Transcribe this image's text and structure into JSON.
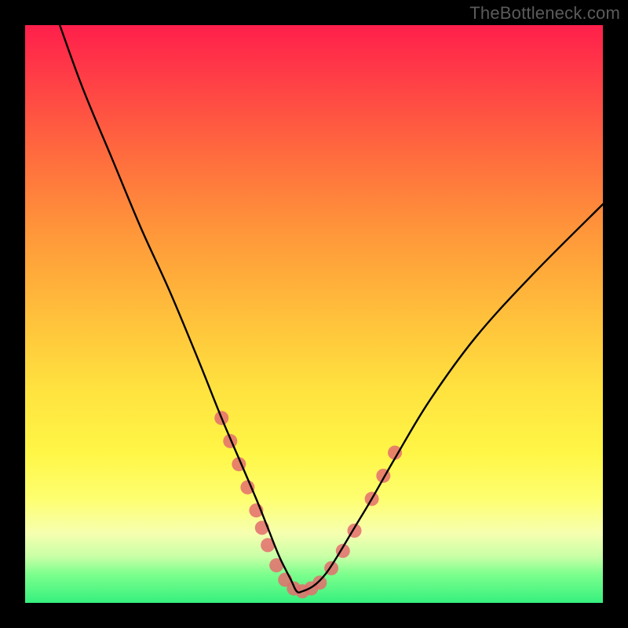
{
  "watermark": "TheBottleneck.com",
  "gradient_stops": [
    {
      "pct": 0,
      "color": "#ff1f4b"
    },
    {
      "pct": 8,
      "color": "#ff3a47"
    },
    {
      "pct": 22,
      "color": "#ff6a3e"
    },
    {
      "pct": 36,
      "color": "#ff973a"
    },
    {
      "pct": 50,
      "color": "#ffbf3b"
    },
    {
      "pct": 63,
      "color": "#ffe23f"
    },
    {
      "pct": 74,
      "color": "#fff646"
    },
    {
      "pct": 82,
      "color": "#feff70"
    },
    {
      "pct": 88,
      "color": "#f6ffb0"
    },
    {
      "pct": 92,
      "color": "#c8ffa6"
    },
    {
      "pct": 95,
      "color": "#7dff8d"
    },
    {
      "pct": 100,
      "color": "#36f07e"
    }
  ],
  "chart_data": {
    "type": "line",
    "title": "",
    "xlabel": "",
    "ylabel": "",
    "xlim": [
      0,
      100
    ],
    "ylim": [
      0,
      100
    ],
    "note": "Axes are unlabeled percent scales inferred from plot extents; y=100 at top, y=0 at bottom. Curve is a bottleneck V-shape with minimum near x≈47.",
    "series": [
      {
        "name": "bottleneck-curve",
        "color": "#000000",
        "x": [
          6,
          10,
          15,
          20,
          25,
          30,
          34,
          37,
          40,
          42,
          44,
          46,
          47,
          48,
          50,
          52,
          54,
          57,
          60,
          64,
          70,
          78,
          88,
          100
        ],
        "y": [
          100,
          89,
          77,
          65,
          54,
          42,
          32,
          25,
          18,
          13,
          8,
          4,
          2,
          2,
          3,
          5,
          8,
          13,
          18,
          25,
          35,
          46,
          57,
          69
        ]
      }
    ],
    "markers": {
      "name": "highlight-dots",
      "color": "#e46d6d",
      "radius_px": 9,
      "points": [
        {
          "x": 34.0,
          "y": 32.0
        },
        {
          "x": 35.5,
          "y": 28.0
        },
        {
          "x": 37.0,
          "y": 24.0
        },
        {
          "x": 38.5,
          "y": 20.0
        },
        {
          "x": 40.0,
          "y": 16.0
        },
        {
          "x": 41.0,
          "y": 13.0
        },
        {
          "x": 42.0,
          "y": 10.0
        },
        {
          "x": 43.5,
          "y": 6.5
        },
        {
          "x": 45.0,
          "y": 4.0
        },
        {
          "x": 46.5,
          "y": 2.5
        },
        {
          "x": 48.0,
          "y": 2.0
        },
        {
          "x": 49.5,
          "y": 2.5
        },
        {
          "x": 51.0,
          "y": 3.5
        },
        {
          "x": 53.0,
          "y": 6.0
        },
        {
          "x": 55.0,
          "y": 9.0
        },
        {
          "x": 57.0,
          "y": 12.5
        },
        {
          "x": 60.0,
          "y": 18.0
        },
        {
          "x": 62.0,
          "y": 22.0
        },
        {
          "x": 64.0,
          "y": 26.0
        }
      ]
    }
  }
}
